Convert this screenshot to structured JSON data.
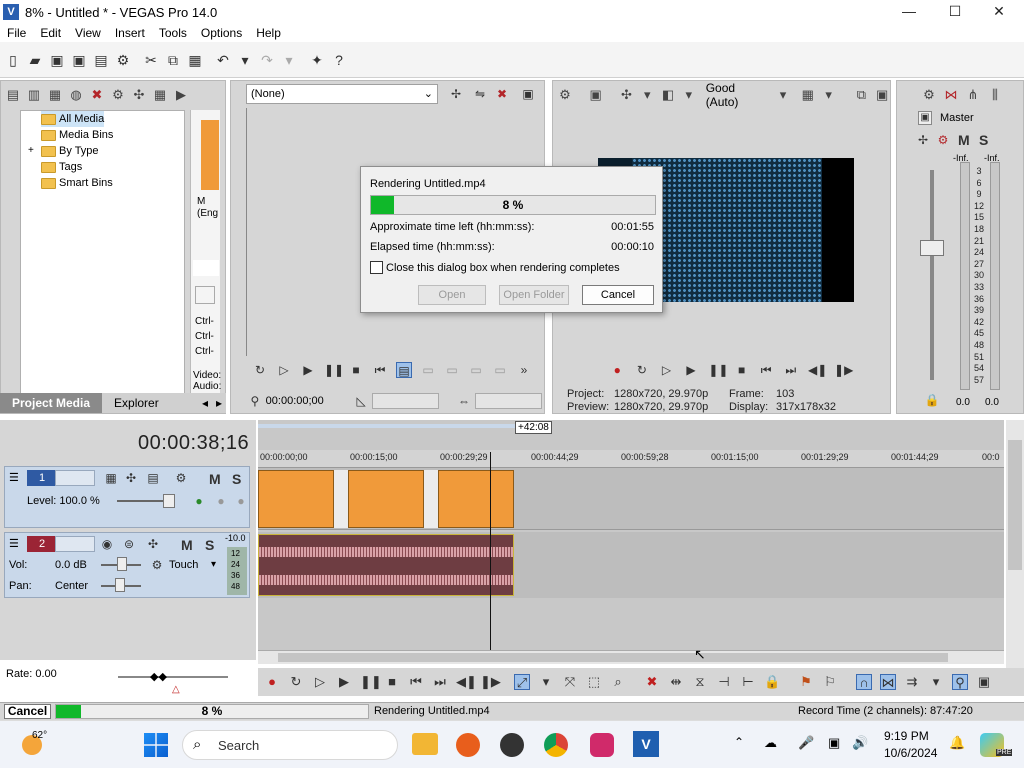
{
  "window": {
    "title": "8% - Untitled * - VEGAS Pro 14.0",
    "logo": "V",
    "min": "—",
    "max": "☐",
    "close": "✕"
  },
  "menu": [
    "File",
    "Edit",
    "View",
    "Insert",
    "Tools",
    "Options",
    "Help"
  ],
  "toolbar_icons": [
    "new-file-icon",
    "open-icon",
    "save-icon",
    "save-as-icon",
    "render-icon",
    "properties-icon",
    "cut-icon",
    "copy-icon",
    "paste-icon",
    "undo-icon",
    "redo-icon",
    "plugin-icon",
    "help-icon"
  ],
  "project_media": {
    "tree": [
      "All Media",
      "Media Bins",
      "By Type",
      "Tags",
      "Smart Bins"
    ],
    "expander": "+",
    "thumb_caption": [
      "M",
      "(Eng"
    ],
    "shortcut_items": [
      "Ctrl-",
      "Ctrl-",
      "Ctrl-"
    ],
    "info": [
      "Video:",
      "Audio:"
    ],
    "tabs": [
      "Project Media",
      "Explorer"
    ]
  },
  "trimmer": {
    "select_value": "(None)",
    "timecode": "00:00:00;00"
  },
  "preview": {
    "quality": "Good (Auto)",
    "project_label": "Project:",
    "project_value": "1280x720, 29.970p",
    "preview_label": "Preview:",
    "preview_value": "1280x720, 29.970p",
    "frame_label": "Frame:",
    "frame_value": "103",
    "display_label": "Display:",
    "display_value": "317x178x32"
  },
  "master": {
    "title": "Master",
    "m": "M",
    "s": "S",
    "inf_left": "-Inf.",
    "inf_right": "-Inf.",
    "scale": [
      "3",
      "6",
      "9",
      "12",
      "15",
      "18",
      "21",
      "24",
      "27",
      "30",
      "33",
      "36",
      "39",
      "42",
      "45",
      "48",
      "51",
      "54",
      "57"
    ],
    "value_left": "0.0",
    "value_right": "0.0"
  },
  "timeline": {
    "timecode": "00:00:38;16",
    "offset": "+42:08",
    "ruler": [
      "00:00:00;00",
      "00:00:15;00",
      "00:00:29;29",
      "00:00:44;29",
      "00:00:59;28",
      "00:01:15;00",
      "00:01:29;29",
      "00:01:44;29",
      "00:0"
    ],
    "video_track": {
      "number": "1",
      "level_label": "Level: 100.0 %",
      "m": "M",
      "s": "S"
    },
    "audio_track": {
      "number": "2",
      "vol_label": "Vol:",
      "vol_value": "0.0 dB",
      "pan_label": "Pan:",
      "pan_value": "Center",
      "touch": "Touch",
      "m": "M",
      "s": "S",
      "meter_top": "-10.0",
      "meter_scale": [
        "12",
        "24",
        "36",
        "48"
      ]
    },
    "rate": "Rate: 0.00"
  },
  "status": {
    "cancel": "Cancel",
    "percent": "8 %",
    "progress": 0.08,
    "message": "Rendering Untitled.mp4",
    "record_time": "Record Time (2 channels): 87:47:20"
  },
  "dialog": {
    "title": "Rendering Untitled.mp4",
    "percent": "8 %",
    "progress": 0.08,
    "time_left_label": "Approximate time left (hh:mm:ss):",
    "time_left_value": "00:01:55",
    "elapsed_label": "Elapsed time (hh:mm:ss):",
    "elapsed_value": "00:00:10",
    "checkbox_label": "Close this dialog box when rendering completes",
    "open": "Open",
    "open_folder": "Open Folder",
    "cancel": "Cancel"
  },
  "taskbar": {
    "weather": "62°",
    "search": "Search",
    "time": "9:19 PM",
    "date": "10/6/2024",
    "badge": "PRE"
  },
  "colors": {
    "progress": "#10b82a",
    "track_video": "#2f5aa3",
    "track_audio": "#9b2435",
    "clip_orange": "#f09a3a",
    "audio_clip": "#6e3d42"
  }
}
